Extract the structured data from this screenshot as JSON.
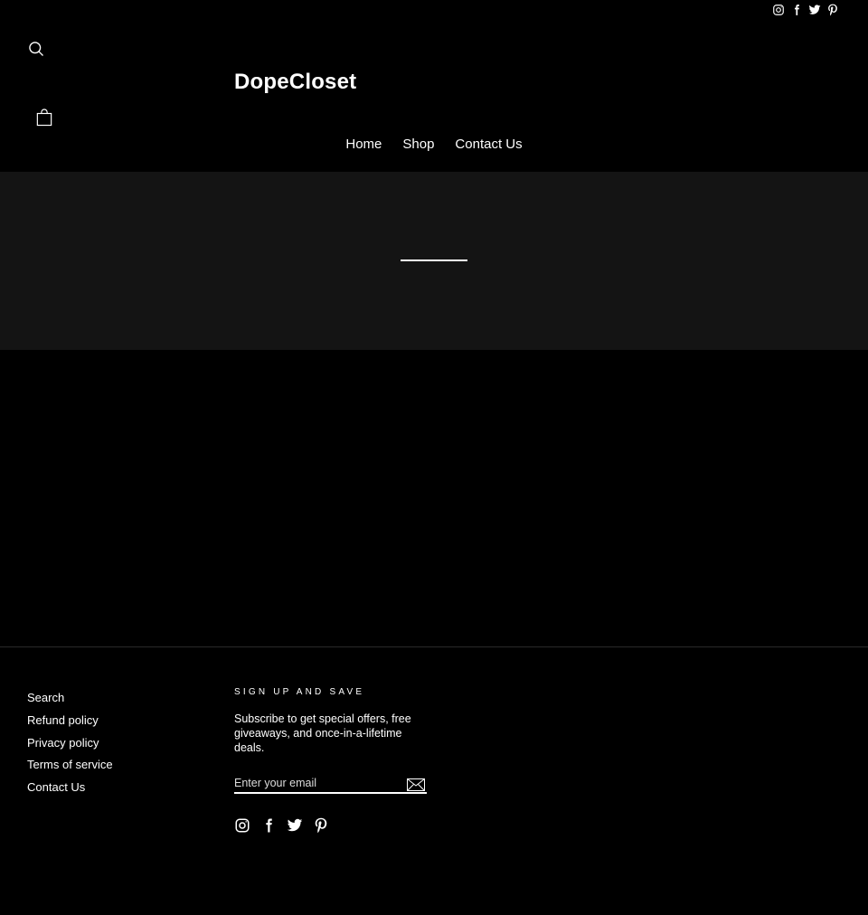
{
  "header": {
    "logo": "DopeCloset",
    "nav": [
      {
        "label": "Home"
      },
      {
        "label": "Shop"
      },
      {
        "label": "Contact Us"
      }
    ],
    "social_icons": [
      "instagram-icon",
      "facebook-icon",
      "twitter-icon",
      "pinterest-icon"
    ]
  },
  "footer": {
    "links": [
      {
        "label": "Search"
      },
      {
        "label": "Refund policy"
      },
      {
        "label": "Privacy policy"
      },
      {
        "label": "Terms of service"
      },
      {
        "label": "Contact Us"
      }
    ],
    "signup": {
      "title": "Sign up and save",
      "text": "Subscribe to get special offers, free giveaways, and once-in-a-lifetime deals.",
      "email_placeholder": "Enter your email"
    },
    "social_icons": [
      "instagram-icon",
      "facebook-icon",
      "twitter-icon",
      "pinterest-icon"
    ]
  },
  "colors": {
    "background": "#000000",
    "hero_background": "#141414",
    "text": "#ffffff"
  }
}
